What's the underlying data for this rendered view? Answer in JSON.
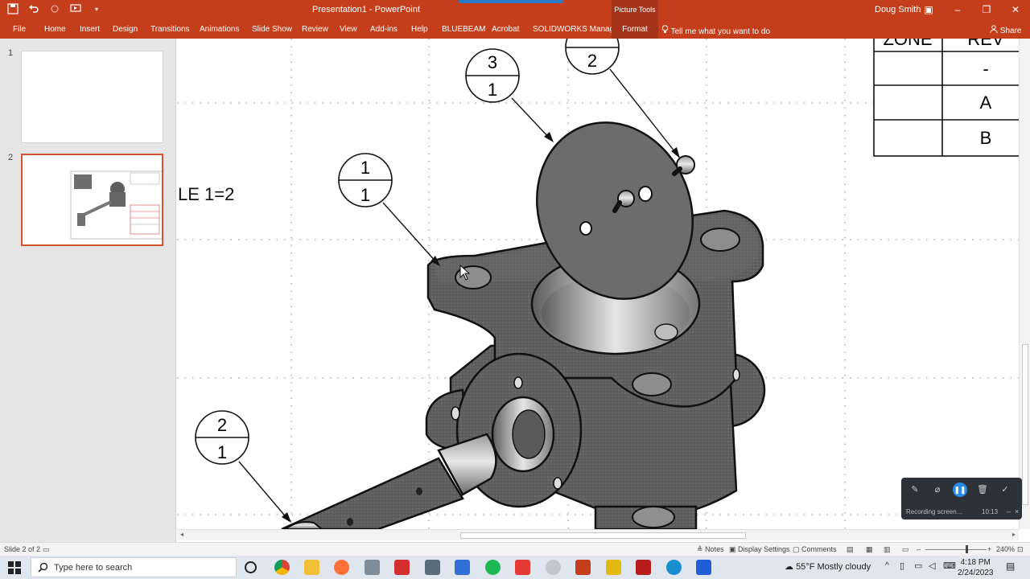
{
  "titlebar": {
    "document_title": "Presentation1  -  PowerPoint",
    "context_group": "Picture Tools",
    "user": "Doug Smith",
    "qat_icons": [
      "save-icon",
      "undo-icon",
      "redo-icon",
      "start-from-beginning-icon",
      "customize-qat-icon"
    ]
  },
  "ribbon": {
    "tabs": [
      "File",
      "Home",
      "Insert",
      "Design",
      "Transitions",
      "Animations",
      "Slide Show",
      "Review",
      "View",
      "Add-ins",
      "Help",
      "BLUEBEAM",
      "Acrobat",
      "SOLIDWORKS Manage",
      "Format"
    ],
    "tell_me": "Tell me what you want to do",
    "share": "Share"
  },
  "slides": [
    {
      "number": "1"
    },
    {
      "number": "2",
      "selected": true
    }
  ],
  "drawing": {
    "scale_text": "LE 1=2",
    "balloons": [
      {
        "top": "3",
        "bottom": "1"
      },
      {
        "top": "",
        "bottom": "2"
      },
      {
        "top": "1",
        "bottom": "1"
      },
      {
        "top": "2",
        "bottom": "1"
      }
    ],
    "revision_table": {
      "headers": [
        "ZONE",
        "REV"
      ],
      "rows": [
        [
          "",
          "-"
        ],
        [
          "",
          "A"
        ],
        [
          "",
          "B"
        ]
      ]
    }
  },
  "statusbar": {
    "slide_info": "Slide 2 of 2",
    "notes": "Notes",
    "display_settings": "Display Settings",
    "comments": "Comments",
    "zoom": "240%"
  },
  "recorder": {
    "label": "Recording screen...",
    "elapsed": "10:13"
  },
  "taskbar": {
    "search_placeholder": "Type here to search",
    "weather": "55°F  Mostly cloudy",
    "time": "4:18 PM",
    "date": "2/24/2023"
  },
  "colors": {
    "ppt_accent": "#c43e1c",
    "part_gray": "#6f6f6f",
    "selection": "#d35230"
  }
}
